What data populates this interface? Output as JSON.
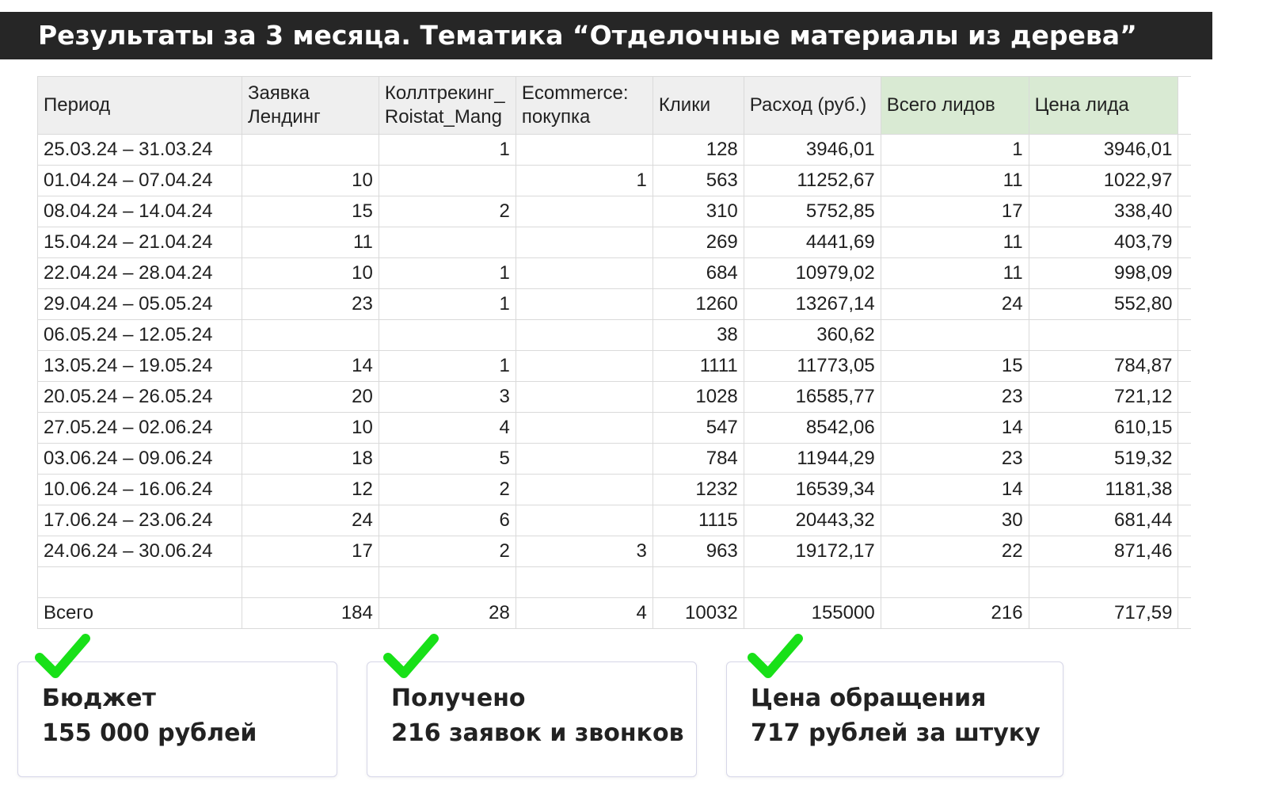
{
  "title": "Результаты за 3 месяца. Тематика “Отделочные материалы из дерева”",
  "colors": {
    "title_bg": "#262626",
    "header_bg": "#efefef",
    "header_green": "#d9ead3",
    "check_green": "#18e018"
  },
  "table": {
    "headers": [
      "Период",
      "Заявка Лендинг",
      "Коллтрекинг_ Roistat_Mang",
      "Ecommerce: покупка",
      "Клики",
      "Расход (руб.)",
      "Всего лидов",
      "Цена лида"
    ],
    "rows": [
      [
        "25.03.24 – 31.03.24",
        "",
        "1",
        "",
        "128",
        "3946,01",
        "1",
        "3946,01"
      ],
      [
        "01.04.24 – 07.04.24",
        "10",
        "",
        "1",
        "563",
        "11252,67",
        "11",
        "1022,97"
      ],
      [
        "08.04.24 – 14.04.24",
        "15",
        "2",
        "",
        "310",
        "5752,85",
        "17",
        "338,40"
      ],
      [
        "15.04.24 – 21.04.24",
        "11",
        "",
        "",
        "269",
        "4441,69",
        "11",
        "403,79"
      ],
      [
        "22.04.24 – 28.04.24",
        "10",
        "1",
        "",
        "684",
        "10979,02",
        "11",
        "998,09"
      ],
      [
        "29.04.24 – 05.05.24",
        "23",
        "1",
        "",
        "1260",
        "13267,14",
        "24",
        "552,80"
      ],
      [
        "06.05.24 – 12.05.24",
        "",
        "",
        "",
        "38",
        "360,62",
        "",
        ""
      ],
      [
        "13.05.24 – 19.05.24",
        "14",
        "1",
        "",
        "1111",
        "11773,05",
        "15",
        "784,87"
      ],
      [
        "20.05.24 – 26.05.24",
        "20",
        "3",
        "",
        "1028",
        "16585,77",
        "23",
        "721,12"
      ],
      [
        "27.05.24 – 02.06.24",
        "10",
        "4",
        "",
        "547",
        "8542,06",
        "14",
        "610,15"
      ],
      [
        "03.06.24 – 09.06.24",
        "18",
        "5",
        "",
        "784",
        "11944,29",
        "23",
        "519,32"
      ],
      [
        "10.06.24 – 16.06.24",
        "12",
        "2",
        "",
        "1232",
        "16539,34",
        "14",
        "1181,38"
      ],
      [
        "17.06.24 – 23.06.24",
        "24",
        "6",
        "",
        "1115",
        "20443,32",
        "30",
        "681,44"
      ],
      [
        "24.06.24 – 30.06.24",
        "17",
        "2",
        "3",
        "963",
        "19172,17",
        "22",
        "871,46"
      ],
      [
        "",
        "",
        "",
        "",
        "",
        "",
        "",
        ""
      ],
      [
        "Всего",
        "184",
        "28",
        "4",
        "10032",
        "155000",
        "216",
        "717,59"
      ]
    ]
  },
  "cards": [
    {
      "line1": "Бюджет",
      "line2": "155 000 рублей"
    },
    {
      "line1": "Получено",
      "line2": "216 заявок и звонков"
    },
    {
      "line1": "Цена обращения",
      "line2": "717 рублей за штуку"
    }
  ]
}
